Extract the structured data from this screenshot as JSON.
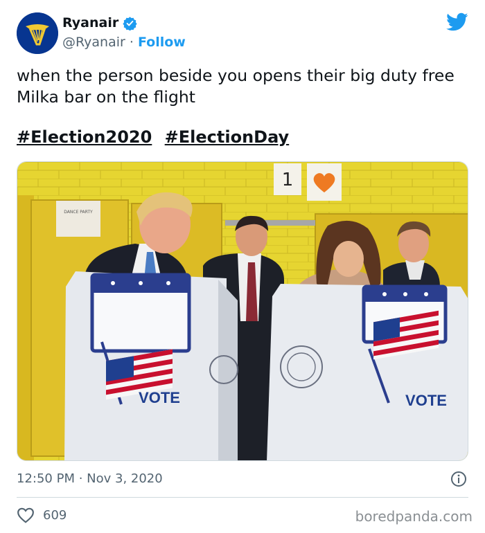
{
  "author": {
    "display_name": "Ryanair",
    "handle": "@Ryanair",
    "separator": "·",
    "follow_label": "Follow",
    "avatar_color": "#073590",
    "avatar_accent": "#f1c933"
  },
  "tweet": {
    "text": "when the person beside you opens their big duty free Milka bar on the flight",
    "hashtags": [
      "#Election2020",
      "#ElectionDay"
    ]
  },
  "photo": {
    "wall_sign_1": "1",
    "booth_label_left": "VOTE",
    "booth_label_right": "VOTE",
    "wall_paper": "DANCE PARTY"
  },
  "meta": {
    "timestamp": "12:50 PM · Nov 3, 2020",
    "likes": "609"
  },
  "watermark": "boredpanda.com",
  "colors": {
    "link": "#1d9bf0",
    "muted": "#536471",
    "wall": "#e8d430",
    "flag_red": "#c8102e",
    "flag_blue": "#1f3f8f"
  }
}
